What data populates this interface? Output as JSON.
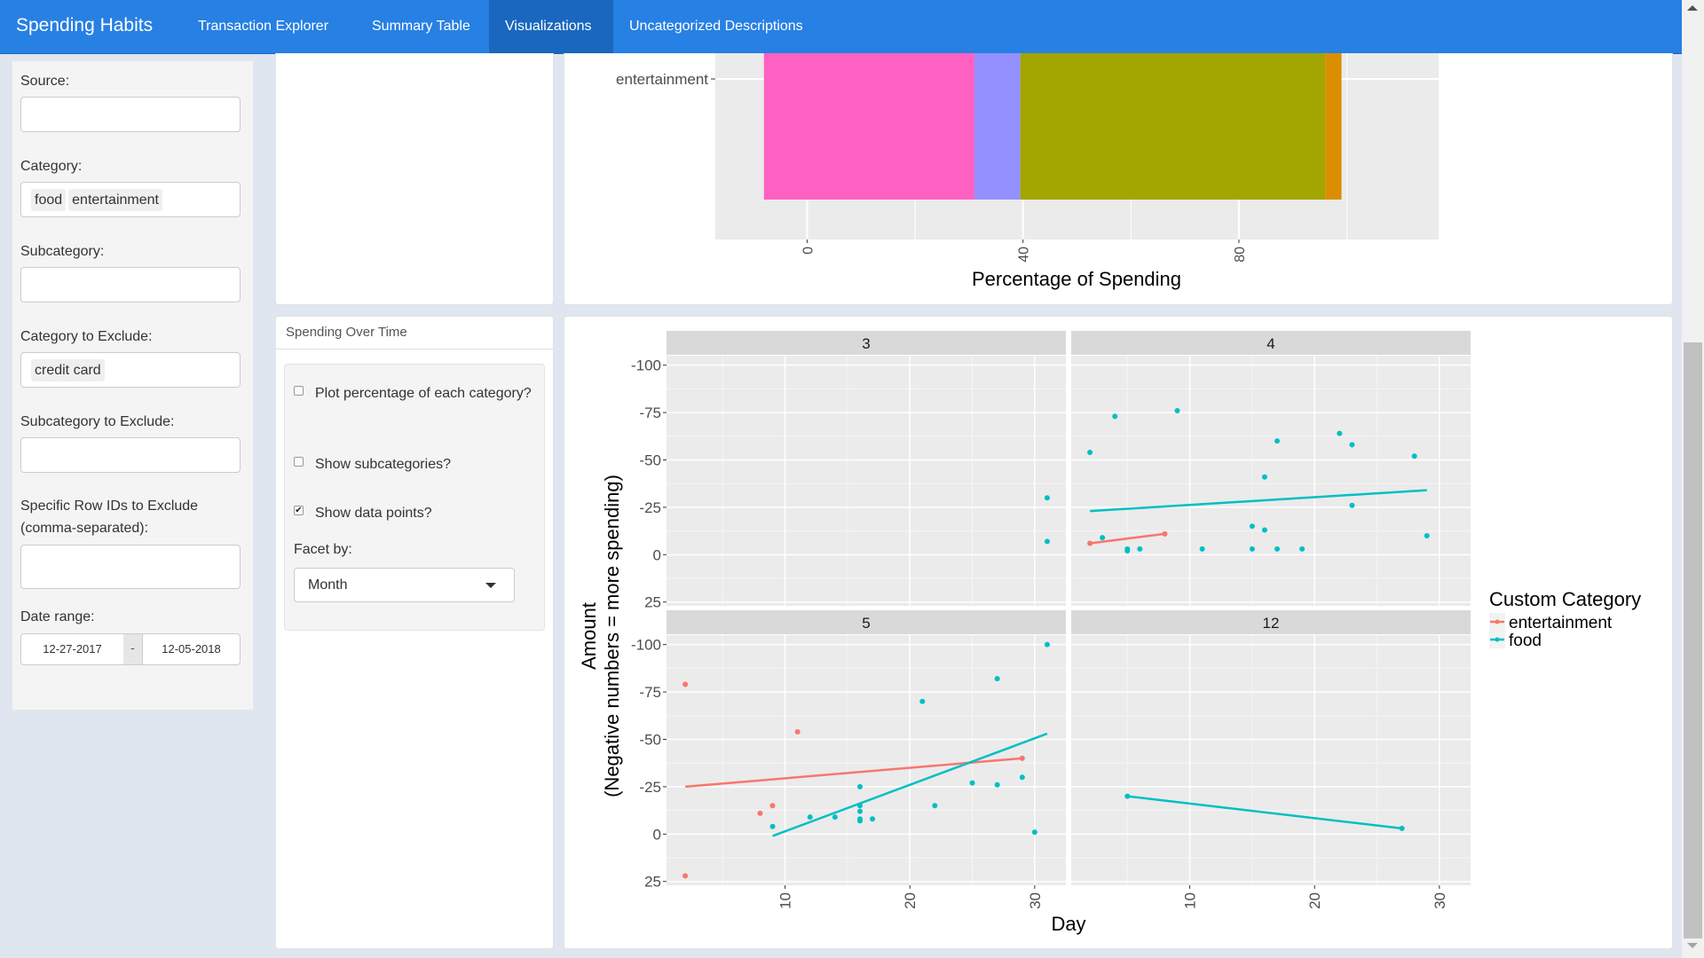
{
  "navbar": {
    "brand": "Spending Habits",
    "tabs": [
      {
        "label": "Transaction Explorer",
        "active": false
      },
      {
        "label": "Summary Table",
        "active": false
      },
      {
        "label": "Visualizations",
        "active": true
      },
      {
        "label": "Uncategorized Descriptions",
        "active": false
      }
    ],
    "color": "#2780e3",
    "active_color": "#1967be"
  },
  "sidebar": {
    "source": {
      "label": "Source:",
      "value": ""
    },
    "category": {
      "label": "Category:",
      "selected": [
        "food",
        "entertainment"
      ]
    },
    "subcategory": {
      "label": "Subcategory:",
      "value": ""
    },
    "category_exclude": {
      "label": "Category to Exclude:",
      "selected": [
        "credit card"
      ]
    },
    "subcategory_exclude": {
      "label": "Subcategory to Exclude:",
      "value": ""
    },
    "row_ids_exclude": {
      "label": "Specific Row IDs to Exclude (comma-separated):",
      "value": ""
    },
    "date_range": {
      "label": "Date range:",
      "start": "12-27-2017",
      "separator": "-",
      "end": "12-05-2018"
    }
  },
  "spending_over_time": {
    "heading": "Spending Over Time",
    "checkboxes": [
      {
        "label": "Plot percentage of each category?",
        "checked": false
      },
      {
        "label": "Show subcategories?",
        "checked": false
      },
      {
        "label": "Show data points?",
        "checked": true
      }
    ],
    "facet": {
      "label": "Facet by:",
      "value": "Month"
    }
  },
  "chart_data": [
    {
      "type": "bar",
      "orientation": "horizontal-stacked",
      "categories": [
        "entertainment"
      ],
      "xlabel": "Percentage of Spending",
      "x_ticks": [
        "0",
        "40",
        "80"
      ],
      "segments": [
        {
          "start": -8,
          "end": 31,
          "color": "#ff61c3"
        },
        {
          "start": 31,
          "end": 39.5,
          "color": "#9590ff"
        },
        {
          "start": 39.5,
          "end": 96,
          "color": "#a3a500"
        },
        {
          "start": 96,
          "end": 99,
          "color": "#db8e00"
        }
      ],
      "xlim": [
        -17,
        117
      ],
      "note": "partially scrolled; only the entertainment bar is visible"
    },
    {
      "type": "scatter",
      "title": "",
      "xlabel": "Day",
      "ylabel": "Amount\n(Negative numbers = more spending)",
      "ylabel_line1": "Amount",
      "ylabel_line2": "(Negative numbers = more spending)",
      "y_reversed": true,
      "ylim": [
        -105,
        27
      ],
      "y_ticks": [
        -100,
        -75,
        -50,
        -25,
        0,
        25
      ],
      "y_tick_labels": [
        "-100",
        "-75",
        "-50",
        "-25",
        "0",
        "25"
      ],
      "xlim": [
        0.5,
        32.5
      ],
      "x_ticks": [
        10,
        20,
        30
      ],
      "x_tick_labels": [
        "10",
        "20",
        "30"
      ],
      "legend": {
        "title": "Custom Category",
        "position": "right",
        "entries": [
          {
            "name": "entertainment",
            "color": "#f8766d"
          },
          {
            "name": "food",
            "color": "#00bfc4"
          }
        ]
      },
      "facets": [
        {
          "label": "3",
          "points": [
            {
              "series": "food",
              "x": 31,
              "y": -30
            },
            {
              "series": "food",
              "x": 31,
              "y": -7
            }
          ],
          "lines": []
        },
        {
          "label": "4",
          "points": [
            {
              "series": "food",
              "x": 2,
              "y": -54
            },
            {
              "series": "food",
              "x": 4,
              "y": -73
            },
            {
              "series": "food",
              "x": 9,
              "y": -76
            },
            {
              "series": "food",
              "x": 3,
              "y": -9
            },
            {
              "series": "food",
              "x": 5,
              "y": -3
            },
            {
              "series": "food",
              "x": 5,
              "y": -2
            },
            {
              "series": "food",
              "x": 6,
              "y": -3
            },
            {
              "series": "food",
              "x": 11,
              "y": -3
            },
            {
              "series": "food",
              "x": 15,
              "y": -3
            },
            {
              "series": "food",
              "x": 15,
              "y": -15
            },
            {
              "series": "food",
              "x": 16,
              "y": -13
            },
            {
              "series": "food",
              "x": 16,
              "y": -41
            },
            {
              "series": "food",
              "x": 17,
              "y": -60
            },
            {
              "series": "food",
              "x": 17,
              "y": -3
            },
            {
              "series": "food",
              "x": 19,
              "y": -3
            },
            {
              "series": "food",
              "x": 22,
              "y": -64
            },
            {
              "series": "food",
              "x": 23,
              "y": -58
            },
            {
              "series": "food",
              "x": 23,
              "y": -26
            },
            {
              "series": "food",
              "x": 28,
              "y": -52
            },
            {
              "series": "food",
              "x": 29,
              "y": -10
            },
            {
              "series": "entertainment",
              "x": 2,
              "y": -6
            },
            {
              "series": "entertainment",
              "x": 8,
              "y": -11
            }
          ],
          "lines": [
            {
              "series": "food",
              "x1": 2,
              "y1": -23,
              "x2": 29,
              "y2": -34
            },
            {
              "series": "entertainment",
              "x1": 2,
              "y1": -6,
              "x2": 8,
              "y2": -11
            }
          ]
        },
        {
          "label": "5",
          "points": [
            {
              "series": "entertainment",
              "x": 2,
              "y": -79
            },
            {
              "series": "entertainment",
              "x": 11,
              "y": -54
            },
            {
              "series": "entertainment",
              "x": 8,
              "y": -11
            },
            {
              "series": "entertainment",
              "x": 9,
              "y": -15
            },
            {
              "series": "entertainment",
              "x": 2,
              "y": 22
            },
            {
              "series": "entertainment",
              "x": 29,
              "y": -40
            },
            {
              "series": "food",
              "x": 9,
              "y": -4
            },
            {
              "series": "food",
              "x": 12,
              "y": -9
            },
            {
              "series": "food",
              "x": 14,
              "y": -9
            },
            {
              "series": "food",
              "x": 16,
              "y": -25
            },
            {
              "series": "food",
              "x": 16,
              "y": -15
            },
            {
              "series": "food",
              "x": 16,
              "y": -12
            },
            {
              "series": "food",
              "x": 16,
              "y": -8
            },
            {
              "series": "food",
              "x": 16,
              "y": -7
            },
            {
              "series": "food",
              "x": 17,
              "y": -8
            },
            {
              "series": "food",
              "x": 21,
              "y": -70
            },
            {
              "series": "food",
              "x": 22,
              "y": -15
            },
            {
              "series": "food",
              "x": 25,
              "y": -27
            },
            {
              "series": "food",
              "x": 27,
              "y": -82
            },
            {
              "series": "food",
              "x": 27,
              "y": -26
            },
            {
              "series": "food",
              "x": 29,
              "y": -30
            },
            {
              "series": "food",
              "x": 30,
              "y": -1
            },
            {
              "series": "food",
              "x": 31,
              "y": -100
            }
          ],
          "lines": [
            {
              "series": "entertainment",
              "x1": 2,
              "y1": -25,
              "x2": 29,
              "y2": -40
            },
            {
              "series": "food",
              "x1": 9,
              "y1": 1,
              "x2": 31,
              "y2": -53
            }
          ]
        },
        {
          "label": "12",
          "points": [
            {
              "series": "food",
              "x": 5,
              "y": -20
            },
            {
              "series": "food",
              "x": 27,
              "y": -3
            }
          ],
          "lines": [
            {
              "series": "food",
              "x1": 5,
              "y1": -20,
              "x2": 27,
              "y2": -3
            }
          ]
        }
      ]
    }
  ]
}
